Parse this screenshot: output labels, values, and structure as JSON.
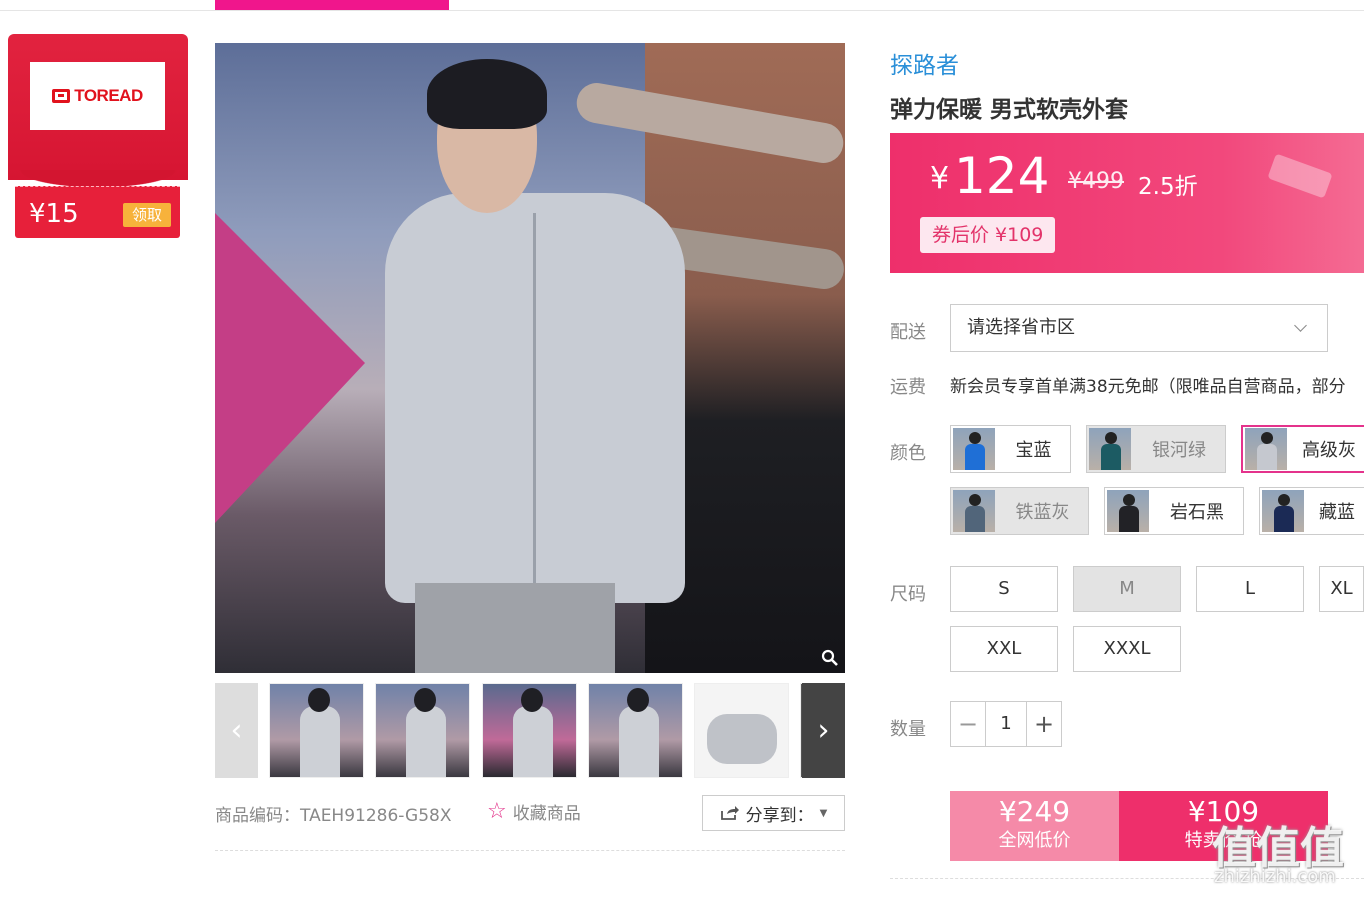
{
  "coupon": {
    "amount": "¥15",
    "button": "领取",
    "brand_logo": "TOREAD"
  },
  "product": {
    "brand": "探路者",
    "title": "弹力保暖 男式软壳外套",
    "price_symbol": "¥",
    "price": "124",
    "original_price": "¥499",
    "discount": "2.5折",
    "after_coupon": "券后价 ¥109"
  },
  "gallery": {
    "sku": "商品编码：TAEH91286-G58X",
    "favorite": "收藏商品",
    "share": "分享到：",
    "prev_arrow": "‹",
    "next_arrow": "›"
  },
  "delivery": {
    "label": "配送",
    "placeholder": "请选择省市区"
  },
  "shipping": {
    "label": "运费",
    "text": "新会员专享首单满38元免邮（限唯品自营商品，部分"
  },
  "colors": {
    "label": "颜色",
    "items": [
      {
        "name": "宝蓝",
        "state": "normal",
        "jacket": "#1f6fd6"
      },
      {
        "name": "银河绿",
        "state": "disabled",
        "jacket": "#1c5b63"
      },
      {
        "name": "高级灰",
        "state": "selected",
        "jacket": "#c5c8cf"
      },
      {
        "name": "铁蓝灰",
        "state": "disabled",
        "jacket": "#51657a"
      },
      {
        "name": "岩石黑",
        "state": "normal",
        "jacket": "#222226"
      },
      {
        "name": "藏蓝",
        "state": "normal",
        "jacket": "#1b2a55"
      }
    ]
  },
  "sizes": {
    "label": "尺码",
    "items": [
      {
        "name": "S",
        "state": "normal"
      },
      {
        "name": "M",
        "state": "disabled"
      },
      {
        "name": "L",
        "state": "normal"
      },
      {
        "name": "XL",
        "state": "normal"
      },
      {
        "name": "XXL",
        "state": "normal"
      },
      {
        "name": "XXXL",
        "state": "normal"
      }
    ]
  },
  "quantity": {
    "label": "数量",
    "value": "1",
    "minus": "−",
    "plus": "+"
  },
  "buy": {
    "left_price": "¥249",
    "left_label": "全网低价",
    "right_price": "¥109",
    "right_label": "特卖价 抢"
  },
  "watermark": {
    "text": "值值值",
    "site": "zhizhizhi.com"
  },
  "colors_theme": {
    "accent": "#ee2f6b",
    "brand_blue": "#2a8fd8",
    "coupon_red": "#e2233f"
  }
}
